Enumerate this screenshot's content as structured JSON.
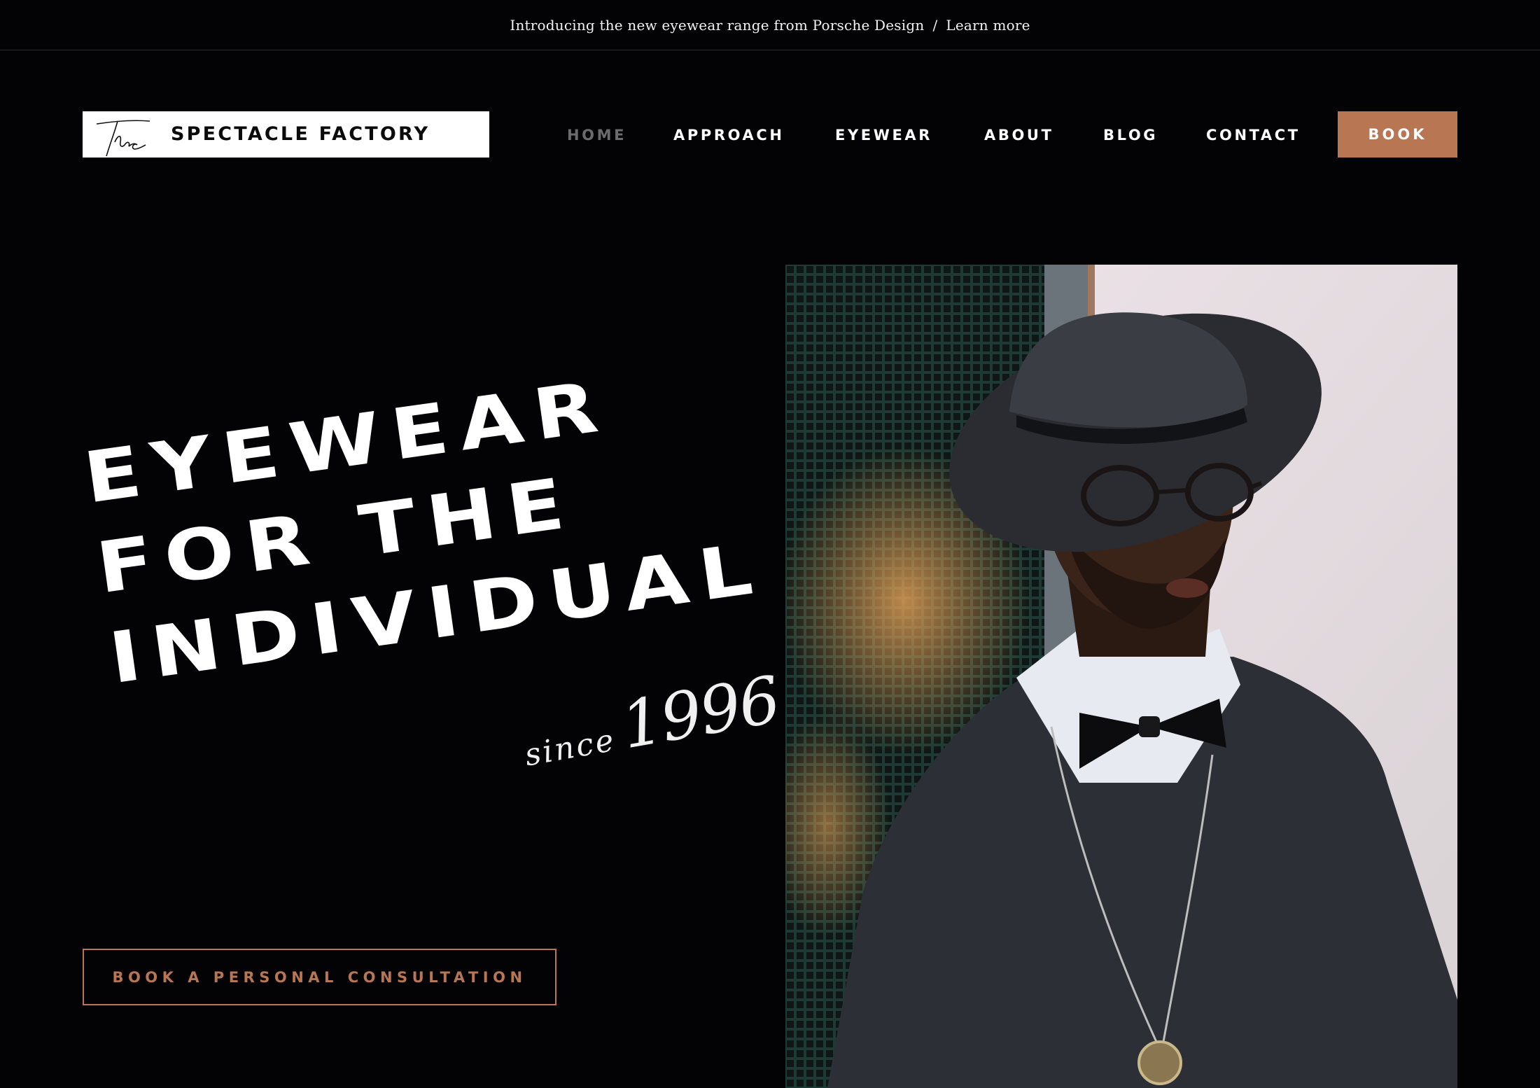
{
  "announcement": {
    "text": "Introducing the new eyewear range from Porsche Design",
    "separator": "/",
    "link_label": "Learn more"
  },
  "logo": {
    "script_word": "The",
    "name": "SPECTACLE FACTORY"
  },
  "nav": {
    "items": [
      {
        "label": "HOME",
        "active": true
      },
      {
        "label": "APPROACH",
        "active": false
      },
      {
        "label": "EYEWEAR",
        "active": false
      },
      {
        "label": "ABOUT",
        "active": false
      },
      {
        "label": "BLOG",
        "active": false
      },
      {
        "label": "CONTACT",
        "active": false
      }
    ],
    "book_label": "BOOK"
  },
  "hero": {
    "headline": [
      "EYEWEAR",
      "FOR THE",
      "INDIVIDUAL"
    ],
    "since_word": "since",
    "since_year": "1996",
    "cta_label": "BOOK A PERSONAL CONSULTATION",
    "photo_description_icon": "portrait-photo"
  },
  "colors": {
    "background": "#030204",
    "accent": "#b87652",
    "nav_active": "#6b6b6b",
    "text": "#ffffff"
  }
}
